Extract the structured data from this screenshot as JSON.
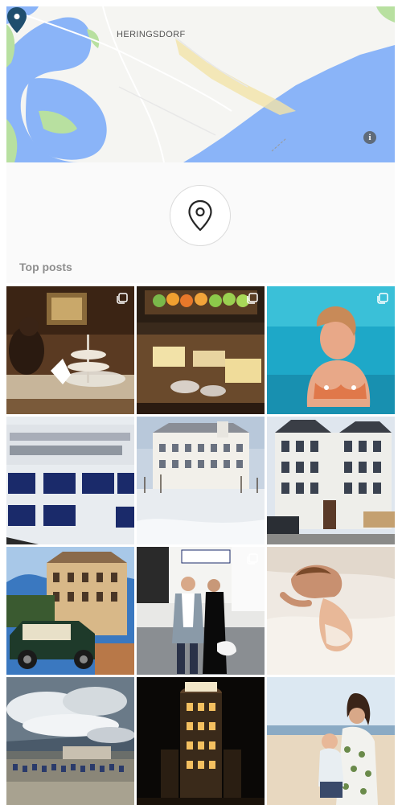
{
  "map": {
    "place_label": "HERINGSDORF",
    "info_glyph": "i",
    "colors": {
      "water": "#8ab4f8",
      "land": "#f5f5f2",
      "green": "#b8e0a0",
      "beach": "#f2e3a8",
      "pin": "#1f4e6e"
    }
  },
  "location": {
    "icon": "location-pin-icon",
    "section_title": "Top posts"
  },
  "posts": [
    {
      "id": "post-1",
      "description": "hotel lounge with afternoon tea tray",
      "multi": true
    },
    {
      "id": "post-2",
      "description": "breakfast buffet with fruit and cheese",
      "multi": true
    },
    {
      "id": "post-3",
      "description": "woman in blue pool",
      "multi": true
    },
    {
      "id": "post-4",
      "description": "Seehotel Ahlbecker Hof sign plaques",
      "multi": false
    },
    {
      "id": "post-5",
      "description": "white hotel facade in winter",
      "multi": false
    },
    {
      "id": "post-6",
      "description": "grand hotel building with towers",
      "multi": false
    },
    {
      "id": "post-7",
      "description": "vintage car in front of hotel",
      "multi": false
    },
    {
      "id": "post-8",
      "description": "couple posing at hotel entrance",
      "multi": true
    },
    {
      "id": "post-9",
      "description": "woman relaxing on white bed",
      "multi": false
    },
    {
      "id": "post-10",
      "description": "beach chairs under dramatic sky",
      "multi": false
    },
    {
      "id": "post-11",
      "description": "hotel tower lit at night",
      "multi": false
    },
    {
      "id": "post-12",
      "description": "mother and child on beach",
      "multi": false
    }
  ]
}
